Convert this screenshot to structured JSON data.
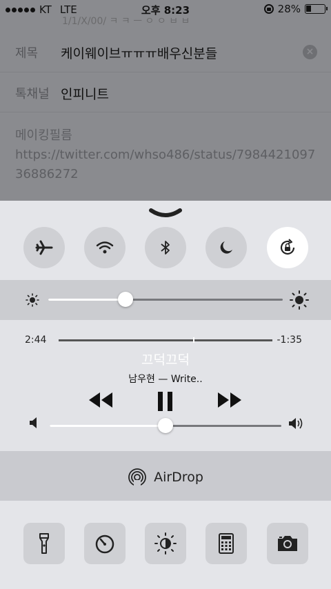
{
  "status_bar": {
    "carrier": "KT",
    "network": "LTE",
    "time": "오후 8:23",
    "battery_percent_label": "28%",
    "battery_level": 0.28
  },
  "background_form": {
    "peek_text": "1/1/X/00/ ㅋ ㅋ ㅡ ㅇ ㅇ ㅂ ㅂ",
    "subject_label": "제목",
    "subject_value": "케이웨이브ㅠㅠㅠ배우신분들",
    "channel_label": "톡채널",
    "channel_value": "인피니트",
    "body_text": "메이킹필름\nhttps://twitter.com/whso486/status/798442109736886272"
  },
  "control_center": {
    "toggles": [
      {
        "name": "airplane-mode",
        "on": false
      },
      {
        "name": "wifi",
        "on": false
      },
      {
        "name": "bluetooth",
        "on": false
      },
      {
        "name": "do-not-disturb",
        "on": false
      },
      {
        "name": "rotation-lock",
        "on": true
      }
    ],
    "brightness": 0.33,
    "now_playing": {
      "elapsed": "2:44",
      "remaining": "-1:35",
      "progress": 0.63,
      "title": "끄덕끄덕",
      "artist": "남우현 — Write..",
      "volume": 0.5
    },
    "airdrop_label": "AirDrop",
    "quick_actions": [
      "flashlight",
      "timer",
      "night-shift",
      "calculator",
      "camera"
    ]
  },
  "colors": {
    "cc_background": "#e4e5e9",
    "toggle_off": "#cfd0d4",
    "toggle_on": "#ffffff"
  }
}
